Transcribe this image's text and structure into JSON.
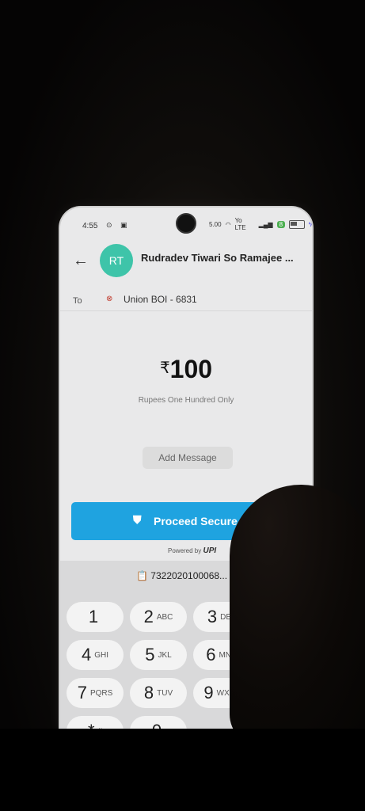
{
  "status_bar": {
    "time": "4:55",
    "speed": "5.00",
    "network": "Yo LTE",
    "badge": "8"
  },
  "header": {
    "avatar_initials": "RT",
    "payee_name": "Rudradev Tiwari So Ramajee ..."
  },
  "to_row": {
    "label": "To",
    "bank": "Union BOI - 6831"
  },
  "amount": {
    "currency_symbol": "₹",
    "value": "100",
    "in_words": "Rupees One Hundred Only"
  },
  "message_button": "Add Message",
  "proceed_button": "Proceed Secure",
  "powered_by": {
    "label": "Powered by",
    "brand": "UPI"
  },
  "clipboard_suggestion": "7322020100068...",
  "keypad": [
    {
      "num": "1",
      "letters": ""
    },
    {
      "num": "2",
      "letters": "ABC"
    },
    {
      "num": "3",
      "letters": "DEF"
    },
    {
      "num": "4",
      "letters": "GHI"
    },
    {
      "num": "5",
      "letters": "JKL"
    },
    {
      "num": "6",
      "letters": "MNO"
    },
    {
      "num": "7",
      "letters": "PQRS"
    },
    {
      "num": "8",
      "letters": "TUV"
    },
    {
      "num": "9",
      "letters": "WXYZ"
    },
    {
      "num": "*",
      "letters": "#"
    },
    {
      "num": "0",
      "letters": ""
    }
  ],
  "colors": {
    "avatar": "#3ec4a9",
    "primary_button": "#1fa3e0"
  }
}
